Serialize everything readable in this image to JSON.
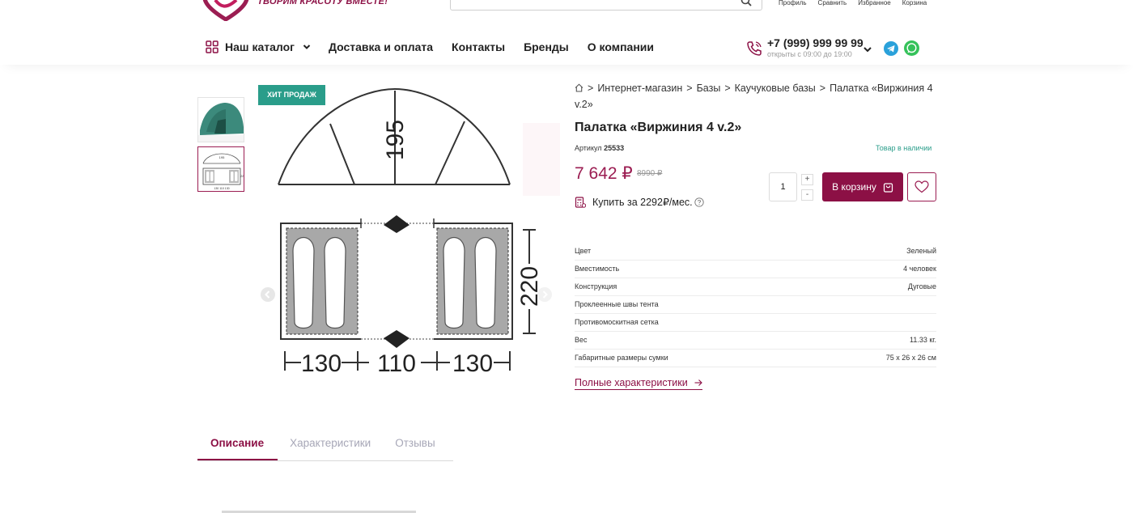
{
  "header": {
    "slogan": "ТВОРИМ КРАСОТУ ВМЕСТЕ!",
    "search": {
      "placeholder": ""
    },
    "user_links": [
      "Профиль",
      "Сравнить",
      "Избранное",
      "Корзина"
    ],
    "catalog_label": "Наш каталог",
    "nav_links": [
      "Доставка и оплата",
      "Контакты",
      "Бренды",
      "О компании"
    ],
    "phone": "+7 (999) 999 99 99",
    "hours": "открыты с 09:00 до 19:00"
  },
  "gallery": {
    "badge": "ХИТ ПРОДАЖ",
    "dimensions": {
      "height": "195",
      "width": "220",
      "left": "130",
      "middle": "110",
      "right": "130"
    },
    "thumb_dims": {
      "h": "195",
      "w": "220",
      "bottom": "130 110 130"
    }
  },
  "breadcrumb": {
    "items": [
      "Интернет-магазин",
      "Базы",
      "Каучуковые базы",
      "Палатка «Виржиния 4 v.2»"
    ],
    "separator": ">"
  },
  "product": {
    "title": "Палатка «Виржиния 4 v.2»",
    "sku_label": "Артикул",
    "sku": "25533",
    "stock": "Товар в наличии",
    "price": "7 642 ₽",
    "old_price": "8990 ₽",
    "credit": "Купить за 2292₽/мес.",
    "qty": "1",
    "plus": "+",
    "minus": "-",
    "cart_label": "В корзину",
    "full_specs": "Полные характеристики"
  },
  "specs": [
    {
      "name": "Цвет",
      "value": "Зеленый"
    },
    {
      "name": "Вместимость",
      "value": "4 человек"
    },
    {
      "name": "Конструкция",
      "value": "Дуговые"
    },
    {
      "name": "Проклеенные швы тента",
      "value": ""
    },
    {
      "name": "Противомоскитная сетка",
      "value": ""
    },
    {
      "name": "Вес",
      "value": "11.33 кг."
    },
    {
      "name": "Габаритные размеры сумки",
      "value": "75 х 26 х 26 см"
    }
  ],
  "tabs": [
    "Описание",
    "Характеристики",
    "Отзывы"
  ],
  "colors": {
    "brand": "#8c1045",
    "accent_green": "#2a9d8a",
    "muted_tab": "#a7a7b7"
  },
  "icons": [
    "logo-heart",
    "search-icon",
    "grid-icon",
    "chevron-down-icon",
    "phone-icon",
    "telegram-icon",
    "whatsapp-icon",
    "home-icon",
    "calculator-icon",
    "question-icon",
    "bag-icon",
    "heart-icon",
    "arrow-right-icon"
  ]
}
